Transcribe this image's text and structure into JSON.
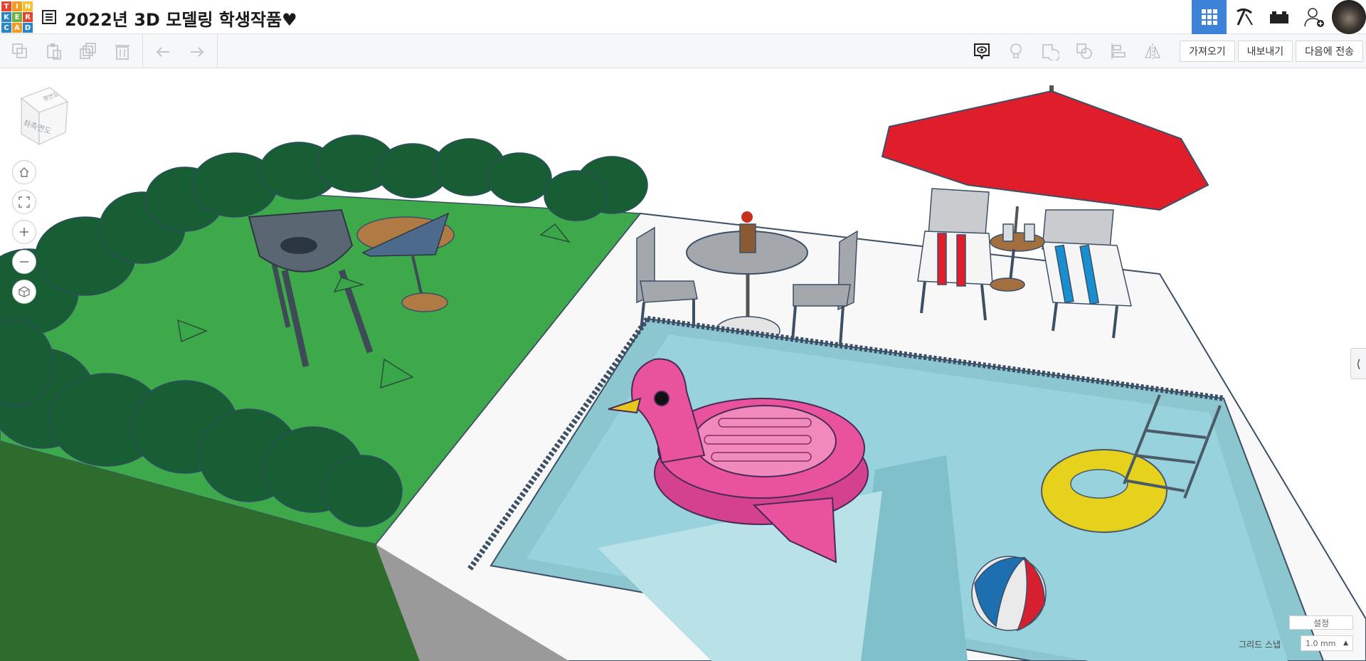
{
  "app": {
    "logo_letters": [
      "T",
      "I",
      "N",
      "K",
      "E",
      "R",
      "C",
      "A",
      "D"
    ],
    "logo_colors": [
      "#e5442f",
      "#f59b23",
      "#f2c12e",
      "#2b86c5",
      "#6cb33f",
      "#e5442f",
      "#2b86c5",
      "#f59b23",
      "#2b86c5"
    ],
    "title": "2022년 3D 모델링 학생작품♥",
    "accent": "#3d82d9"
  },
  "topbar": {
    "buttons": [
      {
        "name": "3d-design-view-button",
        "icon": "grid-icon",
        "active": true
      },
      {
        "name": "codeblocks-view-button",
        "icon": "pickaxe-icon",
        "active": false
      },
      {
        "name": "bricks-view-button",
        "icon": "brick-icon",
        "active": false
      },
      {
        "name": "invite-people-button",
        "icon": "add-user-icon",
        "active": false
      }
    ]
  },
  "toolbar": {
    "left_tools": [
      "copy-icon",
      "paste-icon",
      "duplicate-icon",
      "delete-icon",
      "undo-icon",
      "redo-icon"
    ],
    "right_tools": [
      "show-hide-icon",
      "light-bulb-icon",
      "group-icon",
      "ungroup-icon",
      "align-icon",
      "mirror-icon"
    ],
    "import_label": "가져오기",
    "export_label": "내보내기",
    "send_to_label": "다음에 전송"
  },
  "viewport": {
    "viewcube_face": "좌측면도",
    "viewcube_top": "평면도",
    "nav_buttons": [
      "home-view-icon",
      "fit-all-icon",
      "zoom-in-icon",
      "zoom-out-icon",
      "ortho-perspective-icon"
    ],
    "settings_label": "설정",
    "grid_snap_label": "그리드 스냅",
    "grid_snap_value": "1.0 mm"
  },
  "scene_colors": {
    "grass": "#3aa64a",
    "hedge": "#165c33",
    "pool_water": "#8fd0dc",
    "umbrella": "#e01e2b",
    "flamingo": "#e9539e",
    "ring": "#e6d21c"
  }
}
